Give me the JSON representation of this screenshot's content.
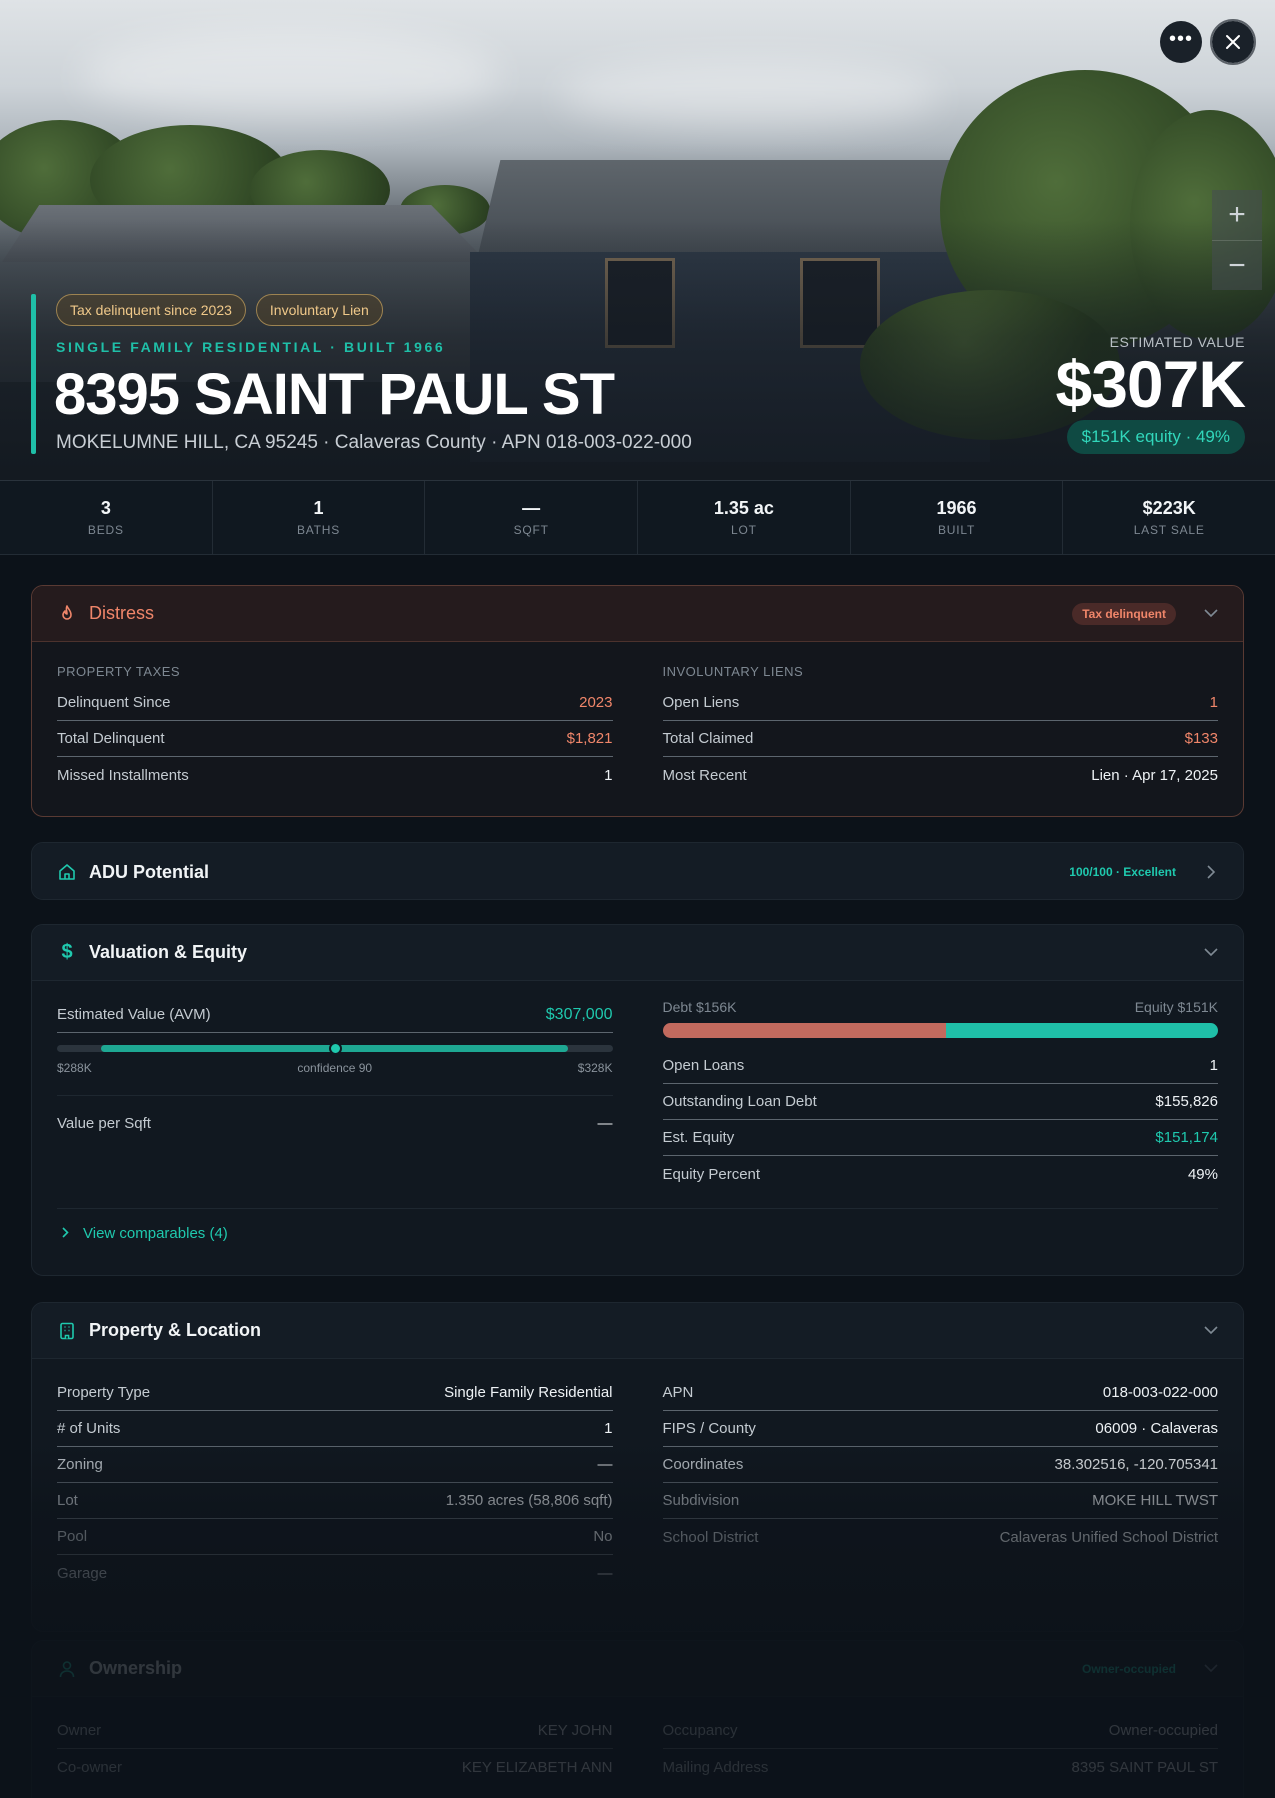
{
  "hero": {
    "tags": [
      "Tax delinquent since 2023",
      "Involuntary Lien"
    ],
    "subtitle": "SINGLE FAMILY RESIDENTIAL · BUILT 1966",
    "address": "8395 SAINT PAUL ST",
    "location": "MOKELUMNE HILL, CA 95245 · Calaveras County · APN 018-003-022-000",
    "estimated_label": "ESTIMATED VALUE",
    "estimated_value": "$307K",
    "equity_pill": "$151K equity · 49%",
    "zoom_in": "+",
    "zoom_out": "−"
  },
  "stats": [
    {
      "value": "3",
      "label": "BEDS"
    },
    {
      "value": "1",
      "label": "BATHS"
    },
    {
      "value": "—",
      "label": "SQFT"
    },
    {
      "value": "1.35 ac",
      "label": "LOT"
    },
    {
      "value": "1966",
      "label": "BUILT"
    },
    {
      "value": "$223K",
      "label": "LAST SALE"
    }
  ],
  "distress": {
    "title": "Distress",
    "badge": "Tax delinquent",
    "left_label": "PROPERTY TAXES",
    "left_rows": [
      {
        "k": "Delinquent Since",
        "v": "2023"
      },
      {
        "k": "Total Delinquent",
        "v": "$1,821"
      },
      {
        "k": "Missed Installments",
        "v": "1"
      }
    ],
    "right_label": "INVOLUNTARY LIENS",
    "right_rows": [
      {
        "k": "Open Liens",
        "v": "1"
      },
      {
        "k": "Total Claimed",
        "v": "$133"
      },
      {
        "k": "Most Recent",
        "v": "Lien · Apr 17, 2025"
      }
    ]
  },
  "adu": {
    "title": "ADU Potential",
    "score": "100/100 · Excellent"
  },
  "valuation": {
    "title": "Valuation & Equity",
    "avm_label": "Estimated Value (AVM)",
    "avm_value": "$307,000",
    "range_low": "$288K",
    "range_mid": "confidence 90",
    "range_high": "$328K",
    "range_fill_start": 0.08,
    "range_fill_end": 0.92,
    "range_point": 0.5,
    "per_sqft_label": "Value per Sqft",
    "per_sqft_value": "—",
    "debt_label": "Debt $156K",
    "equity_label": "Equity $151K",
    "debt_fraction": 0.51,
    "rows": [
      {
        "k": "Open Loans",
        "v": "1"
      },
      {
        "k": "Outstanding Loan Debt",
        "v": "$155,826"
      },
      {
        "k": "Est. Equity",
        "v": "$151,174"
      },
      {
        "k": "Equity Percent",
        "v": "49%"
      }
    ],
    "comparables": "View comparables (4)"
  },
  "property": {
    "title": "Property & Location",
    "left_rows": [
      {
        "k": "Property Type",
        "v": "Single Family Residential"
      },
      {
        "k": "# of Units",
        "v": "1"
      },
      {
        "k": "Zoning",
        "v": "—"
      },
      {
        "k": "Lot",
        "v": "1.350 acres (58,806 sqft)"
      },
      {
        "k": "Pool",
        "v": "No"
      },
      {
        "k": "Garage",
        "v": "—"
      }
    ],
    "right_rows": [
      {
        "k": "APN",
        "v": "018-003-022-000"
      },
      {
        "k": "FIPS / County",
        "v": "06009 · Calaveras"
      },
      {
        "k": "Coordinates",
        "v": "38.302516, -120.705341"
      },
      {
        "k": "Subdivision",
        "v": "MOKE HILL TWST"
      },
      {
        "k": "School District",
        "v": "Calaveras Unified School District"
      }
    ]
  },
  "ownership": {
    "title": "Ownership",
    "badge": "Owner-occupied",
    "left_rows": [
      {
        "k": "Owner",
        "v": "KEY JOHN"
      },
      {
        "k": "Co-owner",
        "v": "KEY ELIZABETH ANN"
      }
    ],
    "right_rows": [
      {
        "k": "Occupancy",
        "v": "Owner-occupied"
      },
      {
        "k": "Mailing Address",
        "v": "8395 SAINT PAUL ST"
      }
    ]
  },
  "colors": {
    "accent": "#1fc9ae",
    "distress": "#f0866a",
    "tag": "#f0c98a",
    "debt": "#c26a5e",
    "equity": "#1fbfa8"
  },
  "icons": {
    "more": "more-icon",
    "close": "close-icon",
    "distress": "flame-icon",
    "adu": "home-icon",
    "valuation": "dollar-icon",
    "property": "building-icon",
    "ownership": "user-icon",
    "chevron": "chevron-down-icon",
    "chevron_right": "chevron-right-icon"
  }
}
